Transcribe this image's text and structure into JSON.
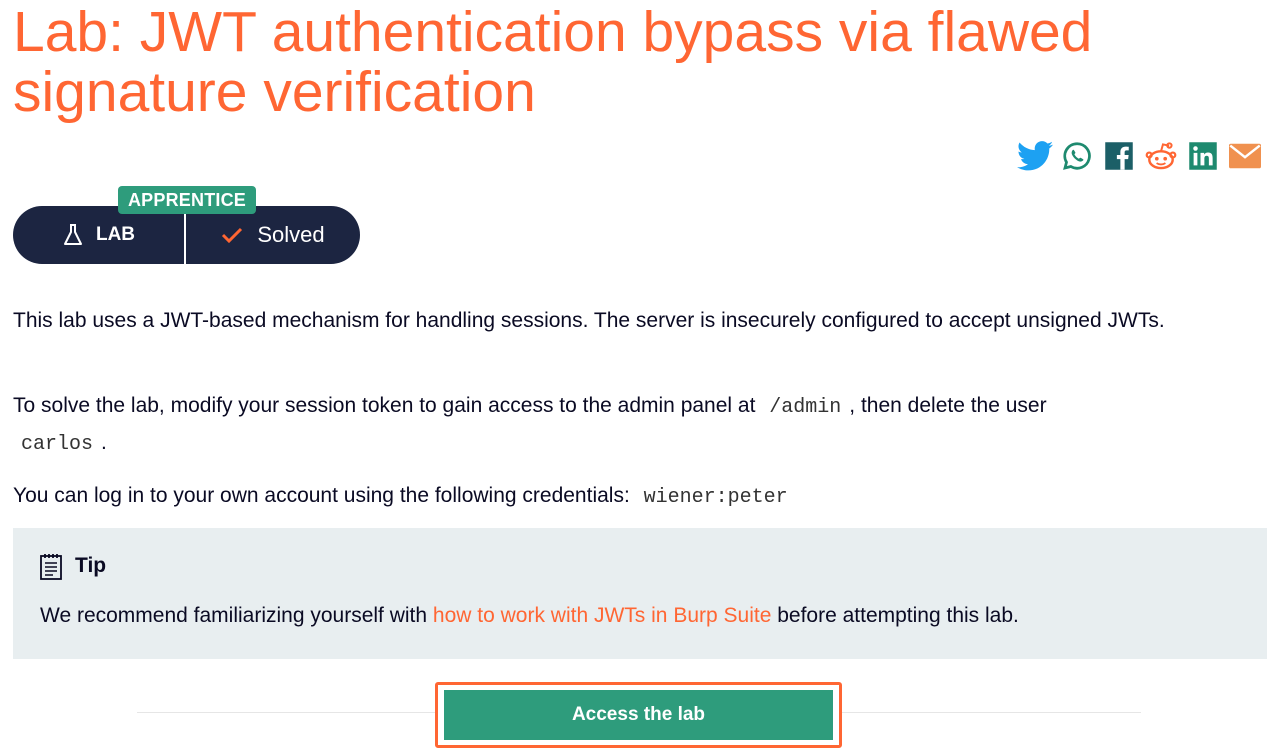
{
  "page": {
    "title": "Lab: JWT authentication bypass via flawed signature verification"
  },
  "share": [
    {
      "icon": "twitter-icon",
      "color": "#1da1f2"
    },
    {
      "icon": "whatsapp-icon",
      "color": "#1e8a6f"
    },
    {
      "icon": "facebook-icon",
      "color": "#1e8a6f"
    },
    {
      "icon": "reddit-icon",
      "color": "#ff6633"
    },
    {
      "icon": "linkedin-icon",
      "color": "#1e8a6f"
    },
    {
      "icon": "email-icon",
      "color": "#f0914f"
    }
  ],
  "badge": {
    "level": "APPRENTICE",
    "type_label": "LAB",
    "status_label": "Solved"
  },
  "description": {
    "p1": "This lab uses a JWT-based mechanism for handling sessions. The server is insecurely configured to accept unsigned JWTs.",
    "p2_a": "To solve the lab, modify your session token to gain access to the admin panel at",
    "p2_code1": "/admin",
    "p2_b": ", then delete the user",
    "p2_code2": "carlos",
    "p2_c": ".",
    "p3_a": "You can log in to your own account using the following credentials:",
    "p3_code": "wiener:peter"
  },
  "tip": {
    "heading": "Tip",
    "text_a": "We recommend familiarizing yourself with",
    "link": "how to work with JWTs in Burp Suite",
    "text_b": "before attempting this lab."
  },
  "cta": {
    "label": "Access the lab"
  },
  "colors": {
    "accent": "#ff6633",
    "brand_green": "#2e9c7c",
    "navy": "#1c2541"
  }
}
